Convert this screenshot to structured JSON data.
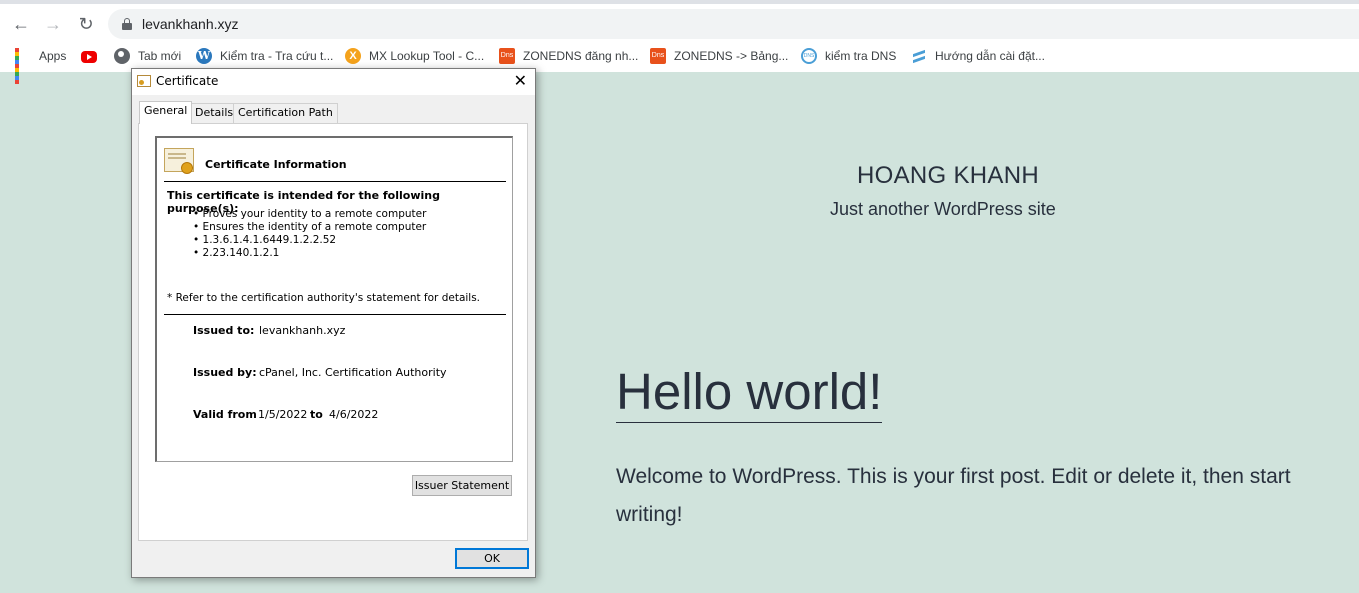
{
  "browser": {
    "url": "levankhanh.xyz",
    "bookmarks": [
      {
        "label": "Apps",
        "icon": "apps-grid-icon"
      },
      {
        "label": "",
        "icon": "youtube-icon"
      },
      {
        "label": "Tab mới",
        "icon": "globe-icon"
      },
      {
        "label": "Kiểm tra - Tra cứu t...",
        "icon": "wordpress-icon"
      },
      {
        "label": "MX Lookup Tool - C...",
        "icon": "mxtoolbox-icon"
      },
      {
        "label": "ZONEDNS đăng nh...",
        "icon": "zonedns-icon"
      },
      {
        "label": "ZONEDNS -> Bảng...",
        "icon": "zonedns-icon"
      },
      {
        "label": "kiểm tra DNS",
        "icon": "dns-check-icon"
      },
      {
        "label": "Hướng dẫn cài đặt...",
        "icon": "book-icon"
      }
    ]
  },
  "site": {
    "title": "HOANG KHANH",
    "description": "Just another WordPress site",
    "post_title": "Hello world!",
    "post_body": "Welcome to WordPress. This is your first post. Edit or delete it, then start writing!"
  },
  "dialog": {
    "title": "Certificate",
    "tabs": [
      "General",
      "Details",
      "Certification Path"
    ],
    "info_heading": "Certificate Information",
    "purpose_heading": "This certificate is intended for the following purpose(s):",
    "purposes": [
      "Proves your identity to a remote computer",
      "Ensures the identity of a remote computer",
      "1.3.6.1.4.1.6449.1.2.2.52",
      "2.23.140.1.2.1"
    ],
    "refer_note": "* Refer to the certification authority's statement for details.",
    "issued_to_label": "Issued to:",
    "issued_to": "levankhanh.xyz",
    "issued_by_label": "Issued by:",
    "issued_by": "cPanel, Inc. Certification Authority",
    "valid_from_label": "Valid from",
    "valid_from": "1/5/2022",
    "valid_to_label": "to",
    "valid_to": "4/6/2022",
    "issuer_statement_button": "Issuer Statement",
    "ok_button": "OK"
  },
  "colors": {
    "page_background": "#d0e3dc",
    "text": "#28303d",
    "dialog_focus": "#0078d7"
  }
}
